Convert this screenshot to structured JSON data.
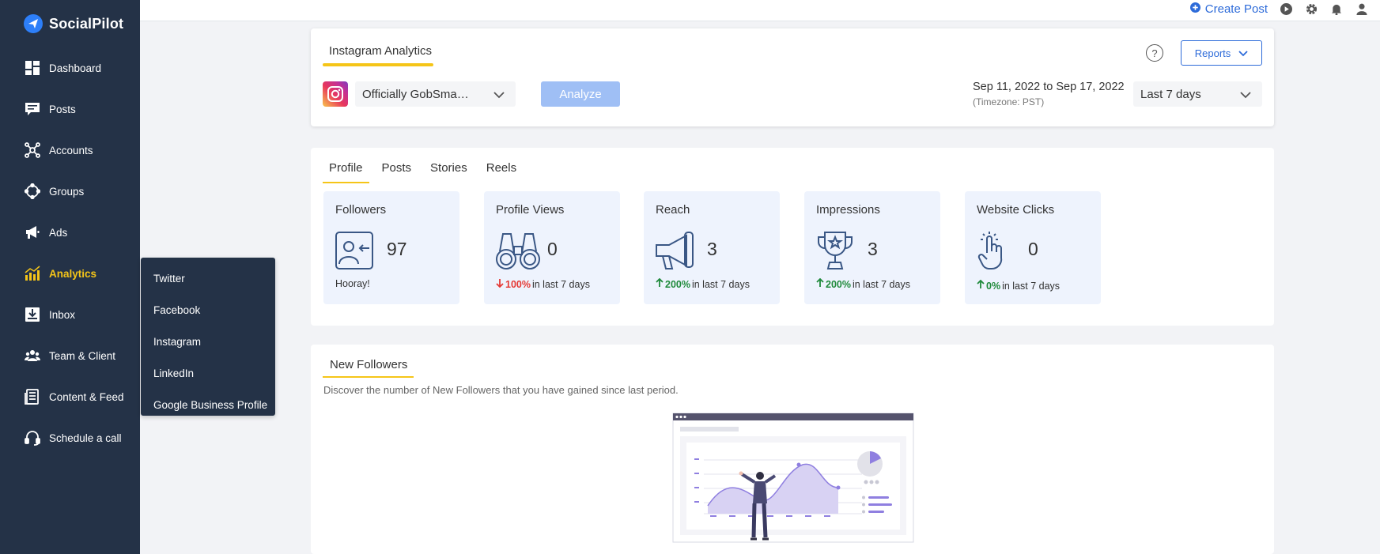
{
  "brand": {
    "name": "SocialPilot"
  },
  "sidebar": {
    "items": [
      {
        "label": "Dashboard",
        "icon": "dashboard-icon"
      },
      {
        "label": "Posts",
        "icon": "posts-icon"
      },
      {
        "label": "Accounts",
        "icon": "accounts-icon"
      },
      {
        "label": "Groups",
        "icon": "groups-icon"
      },
      {
        "label": "Ads",
        "icon": "megaphone-icon"
      },
      {
        "label": "Analytics",
        "icon": "analytics-icon",
        "active": true
      },
      {
        "label": "Inbox",
        "icon": "inbox-icon"
      },
      {
        "label": "Team & Client",
        "icon": "team-icon"
      },
      {
        "label": "Content & Feed",
        "icon": "content-feed-icon"
      },
      {
        "label": "Schedule a call",
        "icon": "headset-icon"
      }
    ]
  },
  "submenu": {
    "items": [
      "Twitter",
      "Facebook",
      "Instagram",
      "LinkedIn",
      "Google Business Profile"
    ]
  },
  "topbar": {
    "create_post": "Create Post",
    "icons": [
      "play-icon",
      "gear-icon",
      "bell-icon",
      "user-icon"
    ]
  },
  "header": {
    "title": "Instagram Analytics",
    "help": "?",
    "reports": "Reports",
    "account": "Officially GobSma…",
    "analyze": "Analyze",
    "date_range": "Sep 11, 2022 to Sep 17, 2022",
    "timezone": "(Timezone: PST)",
    "period": "Last 7 days"
  },
  "tabs": [
    "Profile",
    "Posts",
    "Stories",
    "Reels"
  ],
  "stats": [
    {
      "title": "Followers",
      "value": "97",
      "foot_text": "Hooray!",
      "change": "",
      "direction": "none"
    },
    {
      "title": "Profile Views",
      "value": "0",
      "change": "100%",
      "foot_text": "in last 7 days",
      "direction": "down"
    },
    {
      "title": "Reach",
      "value": "3",
      "change": "200%",
      "foot_text": "in last 7 days",
      "direction": "up"
    },
    {
      "title": "Impressions",
      "value": "3",
      "change": "200%",
      "foot_text": "in last 7 days",
      "direction": "up"
    },
    {
      "title": "Website Clicks",
      "value": "0",
      "change": "0%",
      "foot_text": "in last 7 days",
      "direction": "up"
    }
  ],
  "new_followers": {
    "title": "New Followers",
    "description": "Discover the number of New Followers that you have gained since last period."
  },
  "colors": {
    "sidebar_bg": "#243247",
    "accent_yellow": "#f5c518",
    "primary_blue": "#2d6bd9",
    "tile_bg": "#eef3fd",
    "up_green": "#1f8a3b",
    "down_red": "#e53935"
  }
}
